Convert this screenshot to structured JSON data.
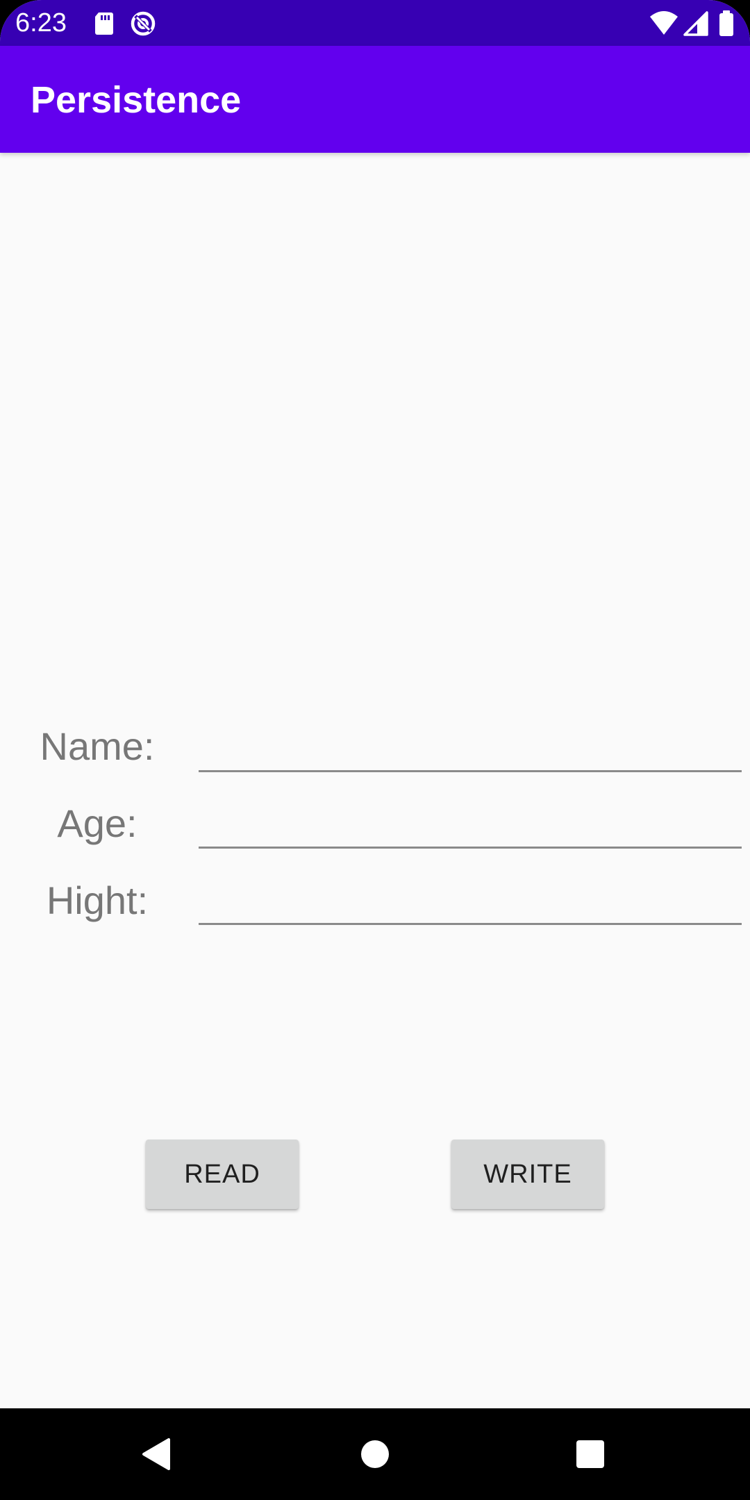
{
  "status_bar": {
    "time": "6:23",
    "icons_left": [
      "sd-card-icon",
      "data-saver-icon"
    ],
    "icons_right": [
      "wifi-icon",
      "signal-icon",
      "battery-icon"
    ],
    "color": "#3700b3"
  },
  "app_bar": {
    "title": "Persistence",
    "color": "#6200ee"
  },
  "form": {
    "name_label": "Name:",
    "name_value": "",
    "age_label": "Age:",
    "age_value": "",
    "height_label": "Hight:",
    "height_value": ""
  },
  "buttons": {
    "read_label": "READ",
    "write_label": "WRITE"
  },
  "nav_bar": {
    "icons": [
      "back-icon",
      "home-icon",
      "recents-icon"
    ]
  }
}
